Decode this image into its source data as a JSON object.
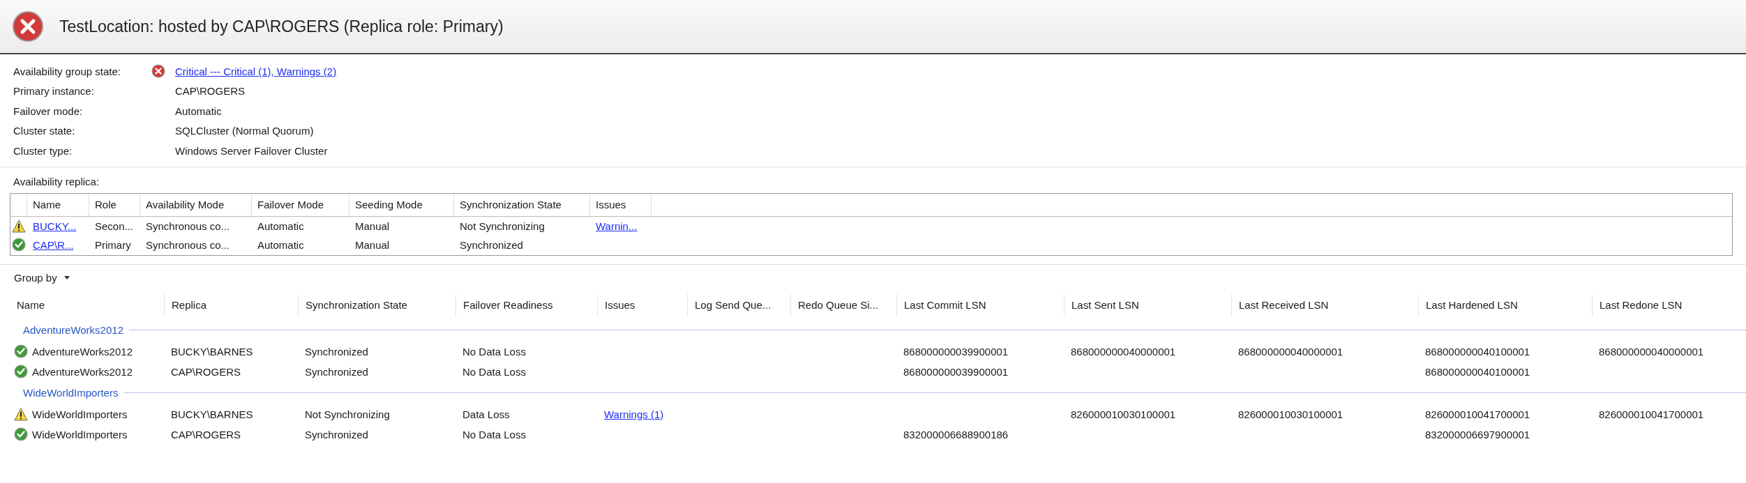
{
  "header": {
    "kind": "error",
    "title": "TestLocation: hosted by CAP\\ROGERS (Replica role: Primary)"
  },
  "properties": [
    {
      "label": "Availability group state:",
      "kind": "status",
      "status": {
        "kind": "error",
        "text": "Critical --- Critical (1), Warnings (2)"
      }
    },
    {
      "label": "Primary instance:",
      "value": "CAP\\ROGERS",
      "kind": "text"
    },
    {
      "label": "Failover mode:",
      "value": "Automatic",
      "kind": "text"
    },
    {
      "label": "Cluster state:",
      "value": "SQLCluster (Normal Quorum)",
      "kind": "text"
    },
    {
      "label": "Cluster type:",
      "value": "Windows Server Failover Cluster",
      "kind": "text"
    }
  ],
  "replica_section": {
    "title": "Availability replica:",
    "columns": [
      "Name",
      "Role",
      "Availability Mode",
      "Failover Mode",
      "Seeding Mode",
      "Synchronization State",
      "Issues"
    ],
    "rows": [
      {
        "kind": "warning",
        "name": "BUCKY...",
        "role": "Secon...",
        "availability_mode": "Synchronous co...",
        "failover_mode": "Automatic",
        "seeding_mode": "Manual",
        "synchronization_state": "Not Synchronizing",
        "issues": "Warnin..."
      },
      {
        "kind": "ok",
        "name": "CAP\\R...",
        "role": "Primary",
        "availability_mode": "Synchronous co...",
        "failover_mode": "Automatic",
        "seeding_mode": "Manual",
        "synchronization_state": "Synchronized"
      }
    ]
  },
  "group_by": {
    "label": "Group by"
  },
  "database_grid": {
    "columns": [
      "Name",
      "Replica",
      "Synchronization State",
      "Failover Readiness",
      "Issues",
      "Log Send Que...",
      "Redo Queue Si...",
      "Last Commit LSN",
      "Last Sent LSN",
      "Last Received LSN",
      "Last Hardened LSN",
      "Last Redone LSN"
    ],
    "groups": [
      {
        "title": "AdventureWorks2012",
        "rows": [
          {
            "kind": "ok",
            "name": "AdventureWorks2012",
            "replica": "BUCKY\\BARNES",
            "synchronization_state": "Synchronized",
            "failover_readiness": "No Data Loss",
            "last_commit_lsn": "868000000039900001",
            "last_sent_lsn": "868000000040000001",
            "last_received_lsn": "868000000040000001",
            "last_hardened_lsn": "868000000040100001",
            "last_redone_lsn": "868000000040000001"
          },
          {
            "kind": "ok",
            "name": "AdventureWorks2012",
            "replica": "CAP\\ROGERS",
            "synchronization_state": "Synchronized",
            "failover_readiness": "No Data Loss",
            "last_commit_lsn": "868000000039900001",
            "last_hardened_lsn": "868000000040100001"
          }
        ]
      },
      {
        "title": "WideWorldImporters",
        "rows": [
          {
            "kind": "warning",
            "name": "WideWorldImporters",
            "replica": "BUCKY\\BARNES",
            "synchronization_state": "Not Synchronizing",
            "failover_readiness": "Data Loss",
            "issues": "Warnings (1)",
            "last_sent_lsn": "826000010030100001",
            "last_received_lsn": "826000010030100001",
            "last_hardened_lsn": "826000010041700001",
            "last_redone_lsn": "826000010041700001"
          },
          {
            "kind": "ok",
            "name": "WideWorldImporters",
            "replica": "CAP\\ROGERS",
            "synchronization_state": "Synchronized",
            "failover_readiness": "No Data Loss",
            "last_commit_lsn": "832000006688900186",
            "last_hardened_lsn": "832000006697900001"
          }
        ]
      }
    ]
  }
}
